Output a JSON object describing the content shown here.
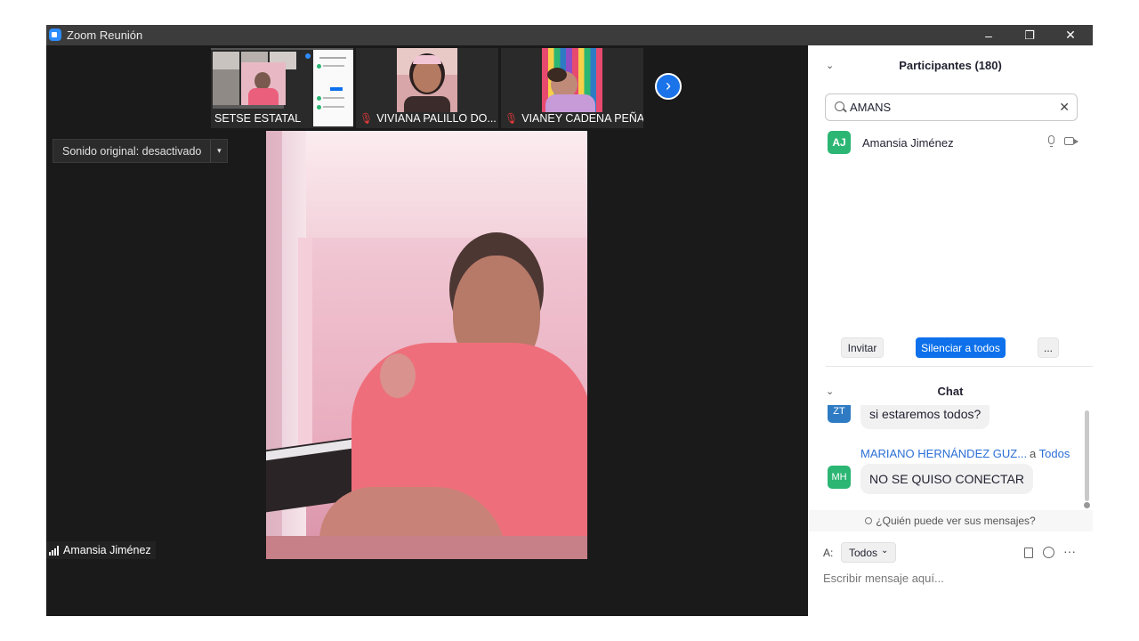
{
  "window": {
    "title": "Zoom Reunión",
    "minimize": "–",
    "restore": "❐",
    "close": "✕"
  },
  "thumbnails": [
    {
      "name": "SETSE ESTATAL",
      "muted": false
    },
    {
      "name": "VIVIANA PALILLO DO...",
      "muted": true
    },
    {
      "name": "VIANEY CADENA PEÑA",
      "muted": true
    }
  ],
  "next_page": "›",
  "original_sound": {
    "label": "Sonido original: desactivado",
    "arrow": "▾"
  },
  "active_speaker": "Amansia Jiménez",
  "participants": {
    "title": "Participantes (180)",
    "collapse": "⌄",
    "search_value": "AMANS",
    "clear": "✕",
    "list": [
      {
        "initials": "AJ",
        "name": "Amansia Jiménez",
        "color": "#2bb673"
      }
    ],
    "invite": "Invitar",
    "mute_all": "Silenciar a todos",
    "more": "..."
  },
  "chat": {
    "title": "Chat",
    "collapse": "⌄",
    "messages": [
      {
        "initials": "ZT",
        "color": "#2e7bc4",
        "text": "si estaremos todos?"
      },
      {
        "initials": "MH",
        "color": "#2bb673",
        "sender": "MARIANO HERNÁNDEZ GUZ...",
        "to_prefix": "a",
        "to": "Todos",
        "text": "NO SE QUISO CONECTAR"
      }
    ],
    "who_can_see": "¿Quién puede ver sus mensajes?",
    "to_label": "A:",
    "recipient": "Todos",
    "recipient_arrow": "⌄",
    "more_tools": "···",
    "placeholder": "Escribir mensaje aquí..."
  }
}
